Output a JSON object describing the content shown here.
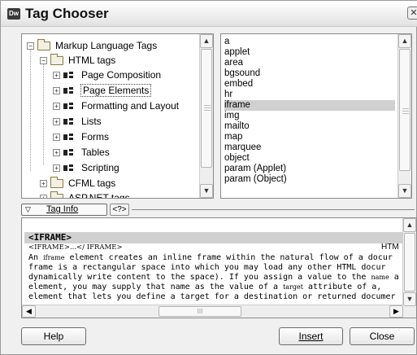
{
  "window": {
    "title": "Tag Chooser",
    "app_badge": "Dw",
    "close_glyph": "✕"
  },
  "tree": {
    "items": [
      {
        "label": "Markup Language Tags",
        "expander": "−",
        "icon": "folder-icon"
      },
      {
        "label": "HTML tags",
        "expander": "−",
        "icon": "folder-icon"
      },
      {
        "label": "Page Composition",
        "expander": "+",
        "icon": "tag-group-icon"
      },
      {
        "label": "Page Elements",
        "expander": "+",
        "icon": "tag-group-icon"
      },
      {
        "label": "Formatting and Layout",
        "expander": "+",
        "icon": "tag-group-icon"
      },
      {
        "label": "Lists",
        "expander": "+",
        "icon": "tag-group-icon"
      },
      {
        "label": "Forms",
        "expander": "+",
        "icon": "tag-group-icon"
      },
      {
        "label": "Tables",
        "expander": "+",
        "icon": "tag-group-icon"
      },
      {
        "label": "Scripting",
        "expander": "+",
        "icon": "tag-group-icon"
      },
      {
        "label": "CFML tags",
        "expander": "+",
        "icon": "folder-icon"
      },
      {
        "label": "ASP.NET tags",
        "expander": "+",
        "icon": "folder-icon"
      }
    ],
    "focused_item": "Page Elements"
  },
  "tag_list": {
    "items": [
      "a",
      "applet",
      "area",
      "bgsound",
      "embed",
      "hr",
      "iframe",
      "img",
      "mailto",
      "map",
      "marquee",
      "object",
      "param (Applet)",
      "param (Object)"
    ],
    "selected": "iframe"
  },
  "tag_info": {
    "tab_label": "Tag Info",
    "tab_arrow": "▽",
    "code_tab": "<?>",
    "title": "<IFRAME>",
    "syntax": "<IFRAME>...</ IFRAME>",
    "source": "HTM",
    "lines": [
      {
        "a": "An ",
        "code": "iframe",
        "b": " element creates an inline frame within the natural flow of a docur"
      },
      {
        "a": "frame is a rectangular space into which you may load any other HTML docur"
      },
      {
        "a": "dynamically write content to the space). If you assign a value to the ",
        "code": "name",
        "b": " at"
      },
      {
        "a": "element, you may supply that name as the value of a ",
        "code": "target",
        "b": " attribute of a,"
      },
      {
        "a": "element that lets you define a target for a destination or returned documer"
      }
    ],
    "hscroll_grip": "III"
  },
  "buttons": {
    "help": "Help",
    "insert": "Insert",
    "close": "Close"
  },
  "scroll_glyphs": {
    "up": "▲",
    "down": "▼",
    "left": "◀",
    "right": "▶"
  }
}
